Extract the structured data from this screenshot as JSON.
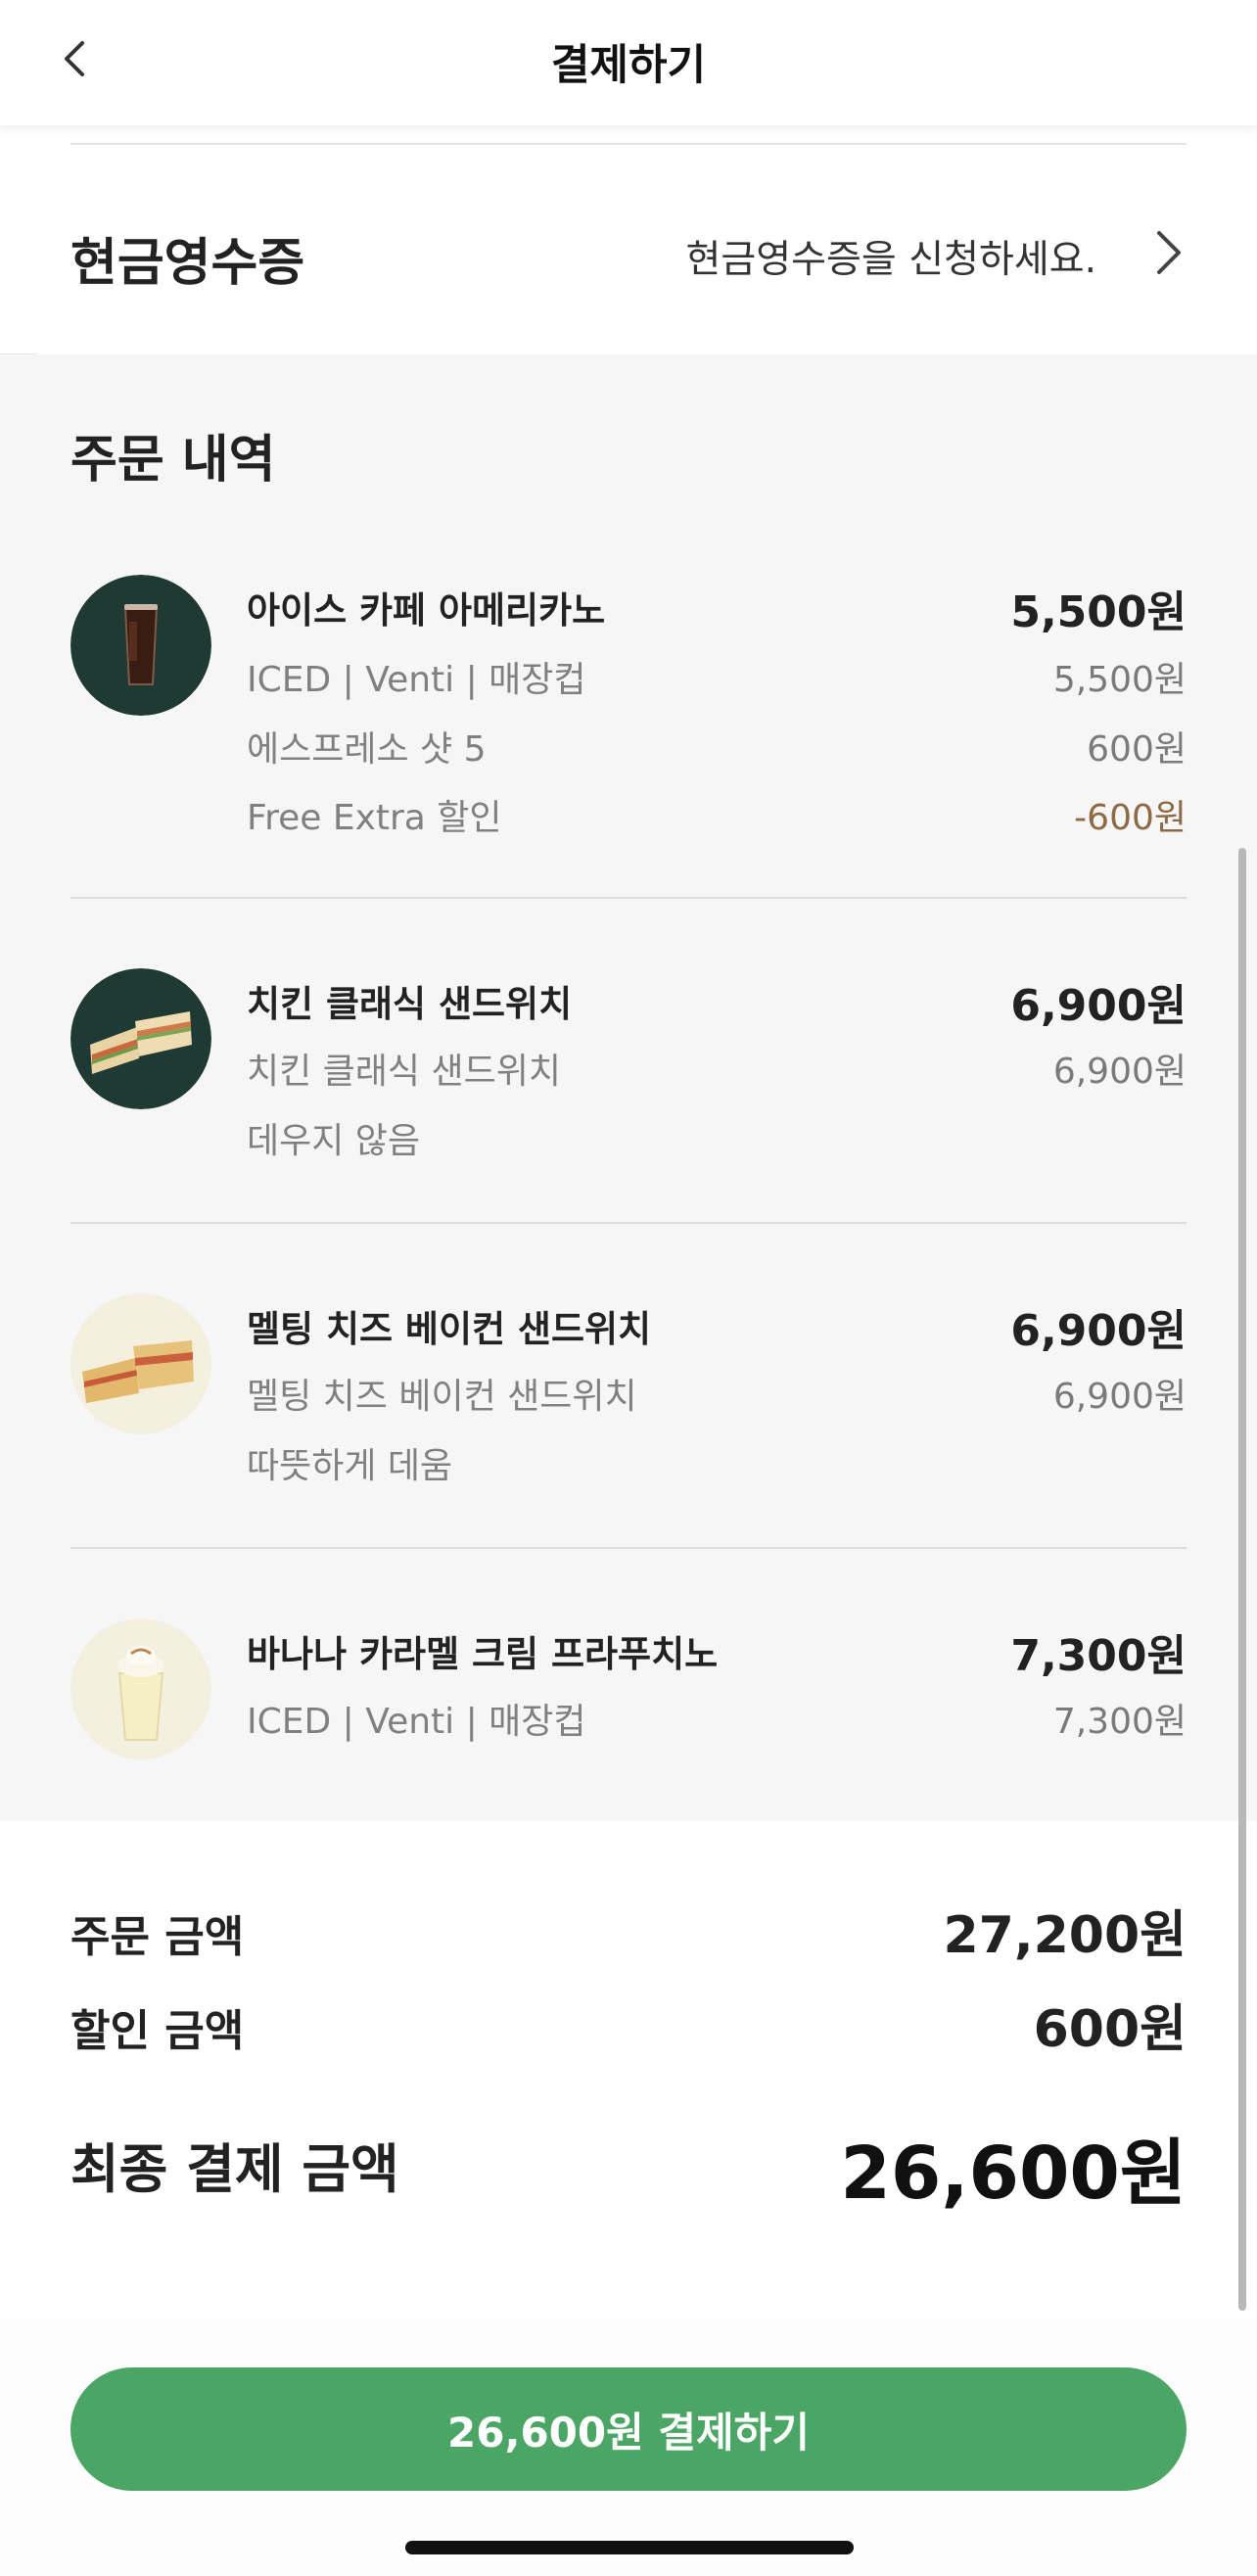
{
  "header": {
    "title": "결제하기",
    "back_icon": "chevron-left-icon"
  },
  "cash_receipt": {
    "label": "현금영수증",
    "action_text": "현금영수증을 신청하세요.",
    "chevron_icon": "chevron-right-icon"
  },
  "order": {
    "title": "주문 내역",
    "items": [
      {
        "name": "아이스 카페 아메리카노",
        "price": "5,500원",
        "image": "iced-americano-image",
        "options": [
          {
            "text": "ICED | Venti | 매장컵",
            "price": "5,500원"
          },
          {
            "text": "에스프레소 샷 5",
            "price": "600원"
          },
          {
            "text": "Free Extra 할인",
            "price": "-600원"
          }
        ]
      },
      {
        "name": "치킨 클래식 샌드위치",
        "price": "6,900원",
        "image": "chicken-sandwich-image",
        "options": [
          {
            "text": "치킨 클래식 샌드위치",
            "price": "6,900원"
          },
          {
            "text": "데우지 않음",
            "price": ""
          }
        ]
      },
      {
        "name": "멜팅 치즈 베이컨 샌드위치",
        "price": "6,900원",
        "image": "bacon-sandwich-image",
        "options": [
          {
            "text": "멜팅 치즈 베이컨 샌드위치",
            "price": "6,900원"
          },
          {
            "text": "따뜻하게 데움",
            "price": ""
          }
        ]
      },
      {
        "name": "바나나 카라멜 크림 프라푸치노",
        "price": "7,300원",
        "image": "frappuccino-image",
        "options": [
          {
            "text": "ICED | Venti | 매장컵",
            "price": "7,300원"
          }
        ]
      }
    ]
  },
  "summary": {
    "order_amount_label": "주문 금액",
    "order_amount": "27,200원",
    "discount_label": "할인 금액",
    "discount_amount": "600원",
    "final_label": "최종 결제 금액",
    "final_amount": "26,600원"
  },
  "pay_button": {
    "label": "26,600원 결제하기"
  },
  "colors": {
    "accent_green": "#4ba665",
    "discount_brown": "#8d6a45",
    "thumb_dark": "#1f3a32",
    "thumb_light": "#f4efdf",
    "section_bg": "#f6f6f6"
  }
}
